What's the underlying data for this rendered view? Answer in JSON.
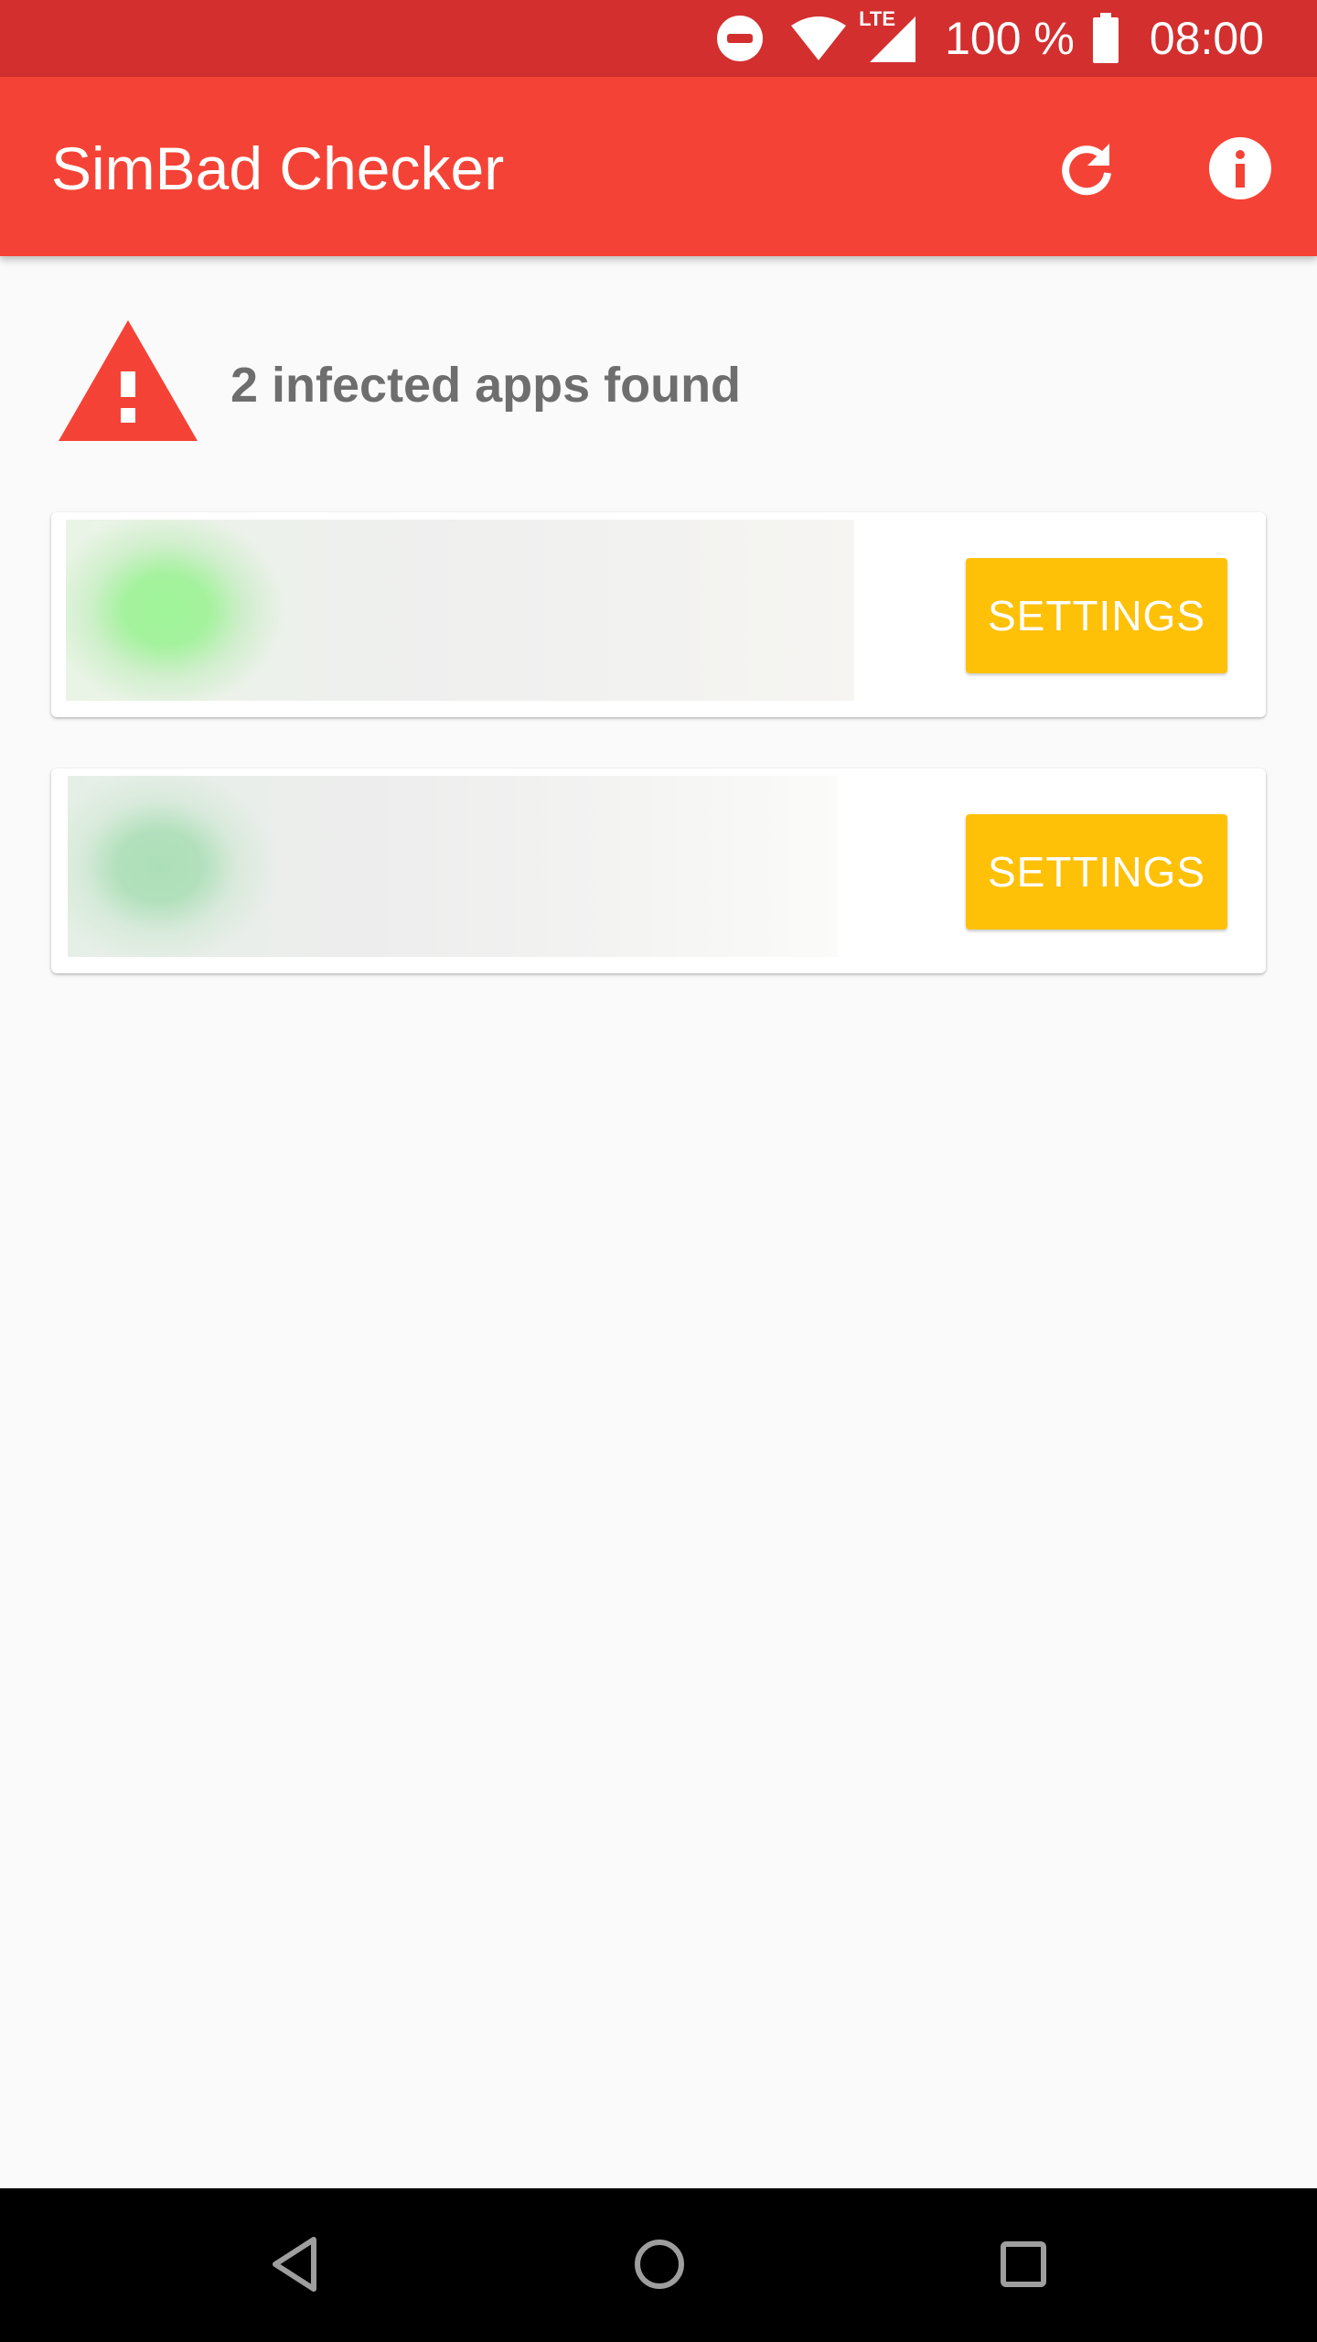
{
  "status_bar": {
    "network_label": "LTE",
    "battery_percent": "100 %",
    "time": "08:00",
    "icons": [
      "do-not-disturb-icon",
      "wifi-icon",
      "cell-signal-icon",
      "battery-icon"
    ]
  },
  "app_bar": {
    "title": "SimBad Checker",
    "actions": [
      {
        "icon": "refresh-icon"
      },
      {
        "icon": "info-icon"
      }
    ]
  },
  "summary": {
    "icon": "warning-icon",
    "message": "2 infected apps found"
  },
  "apps": [
    {
      "settings_label": "SETTINGS"
    },
    {
      "settings_label": "SETTINGS"
    }
  ],
  "nav_bar": {
    "buttons": [
      "back-icon",
      "home-icon",
      "recents-icon"
    ]
  },
  "colors": {
    "status_bar": "#d32f2f",
    "app_bar": "#f44336",
    "warning": "#f44336",
    "settings_button": "#ffc107",
    "summary_text": "#6e6e6e",
    "background": "#fafafa"
  }
}
